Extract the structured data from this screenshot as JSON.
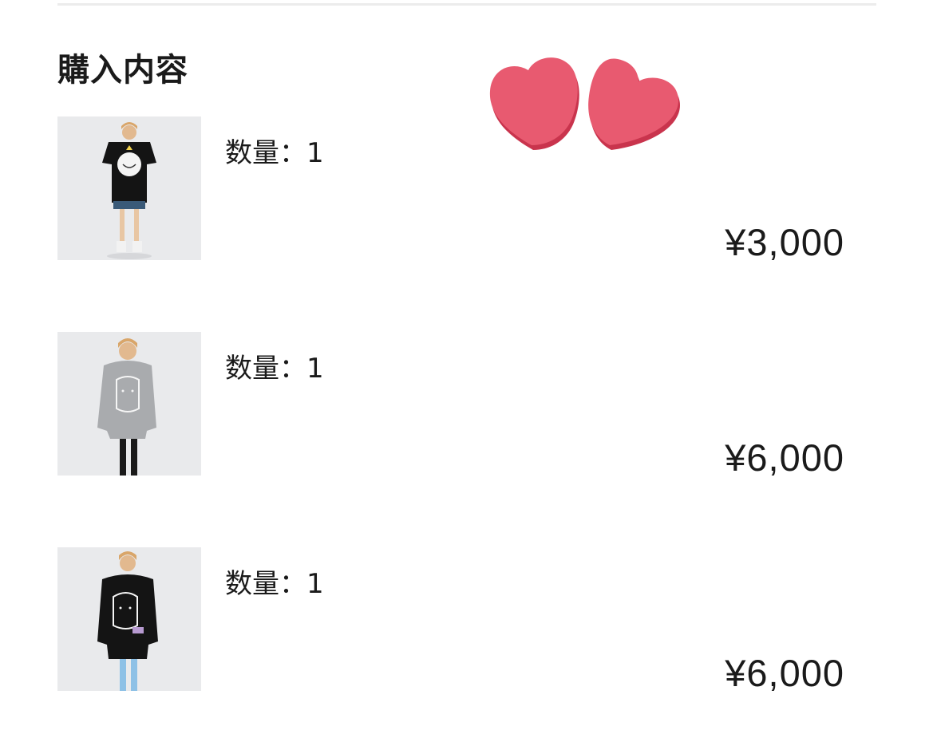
{
  "section": {
    "title": "購入内容"
  },
  "items": [
    {
      "image_desc": "model wearing black oversized t-shirt with cat print",
      "quantity_label": "数量：1",
      "price": "¥3,000"
    },
    {
      "image_desc": "model wearing grey hoodie with cat print",
      "quantity_label": "数量：1",
      "price": "¥6,000"
    },
    {
      "image_desc": "model wearing black hoodie with cat print",
      "quantity_label": "数量：1",
      "price": "¥6,000"
    }
  ],
  "colors": {
    "heart": "#e85a70",
    "heart_shadow": "#c9344d",
    "divider": "#ececec",
    "text": "#1a1a1a"
  },
  "icons": {
    "decoration": "hearts-sticker"
  }
}
